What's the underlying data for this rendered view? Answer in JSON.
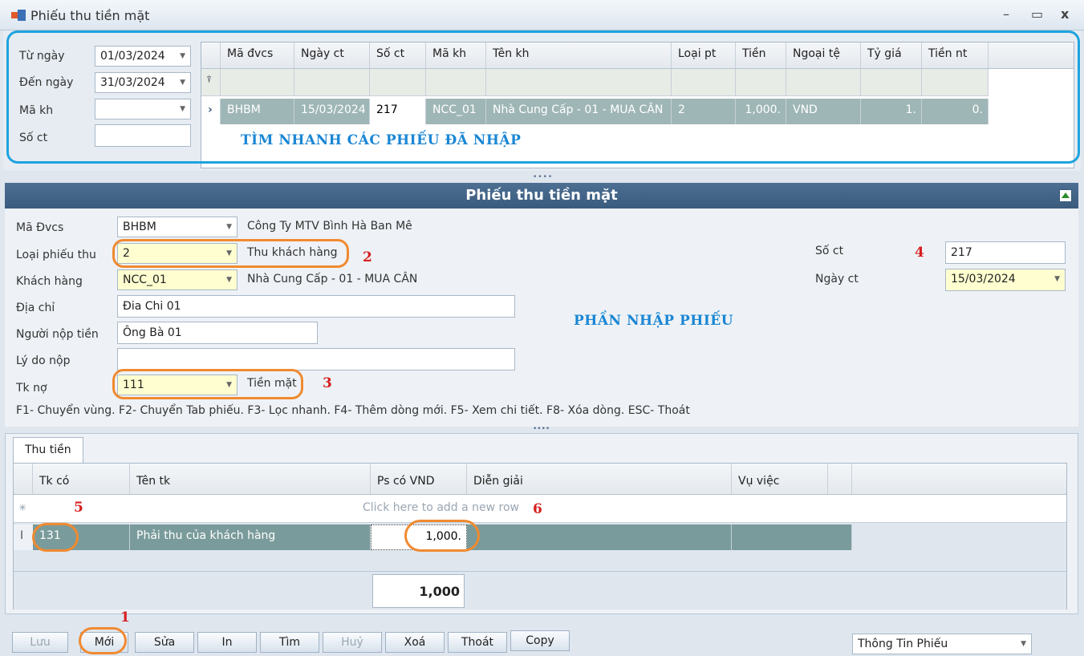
{
  "window": {
    "title": "Phiếu thu tiền mặt",
    "min": "–",
    "max": "▭",
    "close": "x"
  },
  "filter": {
    "from_label": "Từ ngày",
    "from_value": "01/03/2024",
    "to_label": "Đến ngày",
    "to_value": "31/03/2024",
    "customer_label": "Mã kh",
    "customer_value": "",
    "docno_label": "Số ct",
    "docno_value": ""
  },
  "search_grid": {
    "columns": [
      "Mã đvcs",
      "Ngày ct",
      "Số ct",
      "Mã kh",
      "Tên kh",
      "Loại pt",
      "Tiền",
      "Ngoại tệ",
      "Tỷ giá",
      "Tiền nt"
    ],
    "row": [
      "BHBM",
      "15/03/2024",
      "217",
      "NCC_01",
      "Nhà Cung Cấp - 01 - MUA CÂN",
      "2",
      "1,000.",
      "VND",
      "1.",
      "0."
    ],
    "annotation": "TÌM NHANH CÁC PHIẾU ĐÃ NHẬP"
  },
  "form": {
    "header": "Phiếu thu tiền mặt",
    "unit_label": "Mã Đvcs",
    "unit_value": "BHBM",
    "unit_name": "Công Ty MTV Bình Hà Ban Mê",
    "type_label": "Loại phiếu thu",
    "type_value": "2",
    "type_name": "Thu khách hàng",
    "customer_label": "Khách hàng",
    "customer_value": "NCC_01",
    "customer_name": "Nhà Cung Cấp - 01 - MUA CÂN",
    "address_label": "Địa chỉ",
    "address_value": "Đia Chi 01",
    "payer_label": "Người nộp tiền",
    "payer_value": "Ông Bà 01",
    "reason_label": "Lý do nộp",
    "reason_value": "",
    "debit_label": "Tk nợ",
    "debit_value": "111",
    "debit_name": "Tiền mặt",
    "docno_label": "Số ct",
    "docno_value": "217",
    "date_label": "Ngày ct",
    "date_value": "15/03/2024",
    "annotation": "PHẦN NHẬP PHIẾU",
    "hotkeys": "F1- Chuyển vùng. F2- Chuyển Tab phiếu. F3- Lọc nhanh. F4- Thêm dòng mới. F5- Xem chi tiết. F8- Xóa dòng. ESC- Thoát"
  },
  "detail": {
    "tab": "Thu tiền",
    "columns": [
      "Tk có",
      "Tên tk",
      "Ps có VND",
      "Diễn giải",
      "Vụ việc"
    ],
    "new_row_hint": "Click here to add a new row",
    "row": {
      "account": "131",
      "name": "Phải thu của khách hàng",
      "amount": "1,000.",
      "desc": "",
      "case": ""
    },
    "total": "1,000"
  },
  "markers": [
    "1",
    "2",
    "3",
    "4",
    "5",
    "6"
  ],
  "buttons": {
    "save": "Lưu",
    "new": "Mới",
    "edit": "Sửa",
    "print": "In",
    "find": "Tìm",
    "cancel": "Huỷ",
    "delete": "Xoá",
    "exit": "Thoát",
    "copy": "Copy"
  },
  "info_select": "Thông Tin Phiếu",
  "colors": {
    "accent": "#1ea3de",
    "highlight": "#f08a30",
    "marker": "#d61f1f",
    "header": "#3a5b7d"
  }
}
